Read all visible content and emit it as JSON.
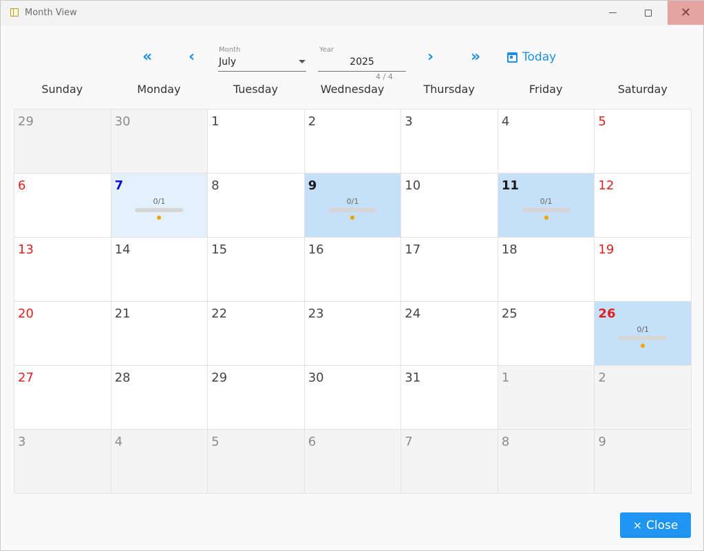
{
  "window": {
    "title": "Month View"
  },
  "nav": {
    "first": "«",
    "prev": "‹",
    "next": "›",
    "last": "»"
  },
  "month_field": {
    "label": "Month",
    "value": "July"
  },
  "year_field": {
    "label": "Year",
    "value": "2025",
    "counter": "4 / 4"
  },
  "today_label": "Today",
  "weekdays": [
    "Sunday",
    "Monday",
    "Tuesday",
    "Wednesday",
    "Thursday",
    "Friday",
    "Saturday"
  ],
  "days": [
    {
      "n": "29",
      "state": "other"
    },
    {
      "n": "30",
      "state": "other"
    },
    {
      "n": "1"
    },
    {
      "n": "2"
    },
    {
      "n": "3"
    },
    {
      "n": "4"
    },
    {
      "n": "5",
      "weekend": true
    },
    {
      "n": "6",
      "weekend": true
    },
    {
      "n": "7",
      "state": "today",
      "tasks": "0/1"
    },
    {
      "n": "8"
    },
    {
      "n": "9",
      "state": "selected",
      "tasks": "0/1"
    },
    {
      "n": "10"
    },
    {
      "n": "11",
      "state": "selected",
      "tasks": "0/1"
    },
    {
      "n": "12",
      "weekend": true
    },
    {
      "n": "13",
      "weekend": true
    },
    {
      "n": "14"
    },
    {
      "n": "15"
    },
    {
      "n": "16"
    },
    {
      "n": "17"
    },
    {
      "n": "18"
    },
    {
      "n": "19",
      "weekend": true
    },
    {
      "n": "20",
      "weekend": true
    },
    {
      "n": "21"
    },
    {
      "n": "22"
    },
    {
      "n": "23"
    },
    {
      "n": "24"
    },
    {
      "n": "25"
    },
    {
      "n": "26",
      "state": "selected",
      "weekend": true,
      "tasks": "0/1"
    },
    {
      "n": "27",
      "weekend": true
    },
    {
      "n": "28"
    },
    {
      "n": "29"
    },
    {
      "n": "30"
    },
    {
      "n": "31"
    },
    {
      "n": "1",
      "state": "other"
    },
    {
      "n": "2",
      "state": "other"
    },
    {
      "n": "3",
      "state": "other"
    },
    {
      "n": "4",
      "state": "other"
    },
    {
      "n": "5",
      "state": "other"
    },
    {
      "n": "6",
      "state": "other"
    },
    {
      "n": "7",
      "state": "other"
    },
    {
      "n": "8",
      "state": "other"
    },
    {
      "n": "9",
      "state": "other"
    }
  ],
  "close_button": {
    "label": "Close",
    "icon": "×"
  },
  "colors": {
    "accent": "#1e8fe6",
    "weekend": "#e02020",
    "today": "#1010d0",
    "selected_bg": "#c6e0f7",
    "task_dot": "#f0a400"
  }
}
